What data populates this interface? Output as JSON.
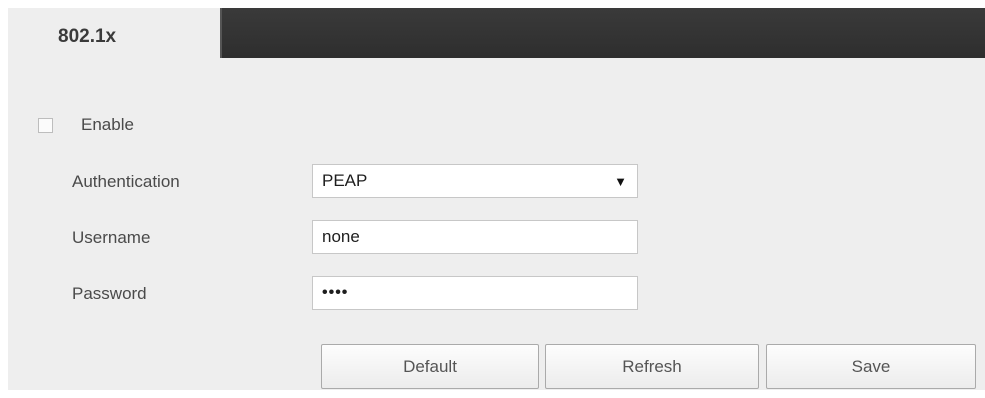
{
  "tabs": {
    "active_label": "802.1x"
  },
  "form": {
    "enable_label": "Enable",
    "enable_checked": false,
    "authentication": {
      "label": "Authentication",
      "value": "PEAP",
      "caret": "▼"
    },
    "username": {
      "label": "Username",
      "value": "none"
    },
    "password": {
      "label": "Password",
      "value": "••••"
    }
  },
  "buttons": {
    "default_label": "Default",
    "refresh_label": "Refresh",
    "save_label": "Save"
  },
  "icons": {
    "caret": "chevron-down-icon"
  }
}
